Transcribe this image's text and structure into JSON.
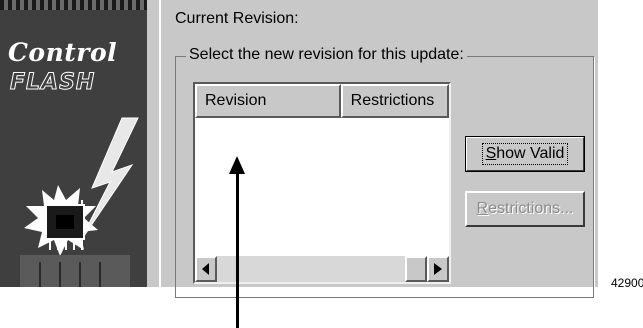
{
  "logo": {
    "line1": "Control",
    "line2": "FLASH"
  },
  "dialog": {
    "current_revision_label": "Current Revision:",
    "group_label": "Select the new revision for this update:",
    "list": {
      "columns": [
        "Revision",
        "Restrictions"
      ],
      "rows": []
    },
    "buttons": {
      "show_valid": {
        "mnemonic": "S",
        "rest": "how Valid"
      },
      "restrictions": {
        "mnemonic": "R",
        "rest": "estrictions..."
      }
    }
  },
  "figure_number": "42900",
  "colors": {
    "dialog_bg": "#c8c8c8",
    "list_bg": "#ffffff",
    "disabled_text": "#8c8c8c"
  }
}
